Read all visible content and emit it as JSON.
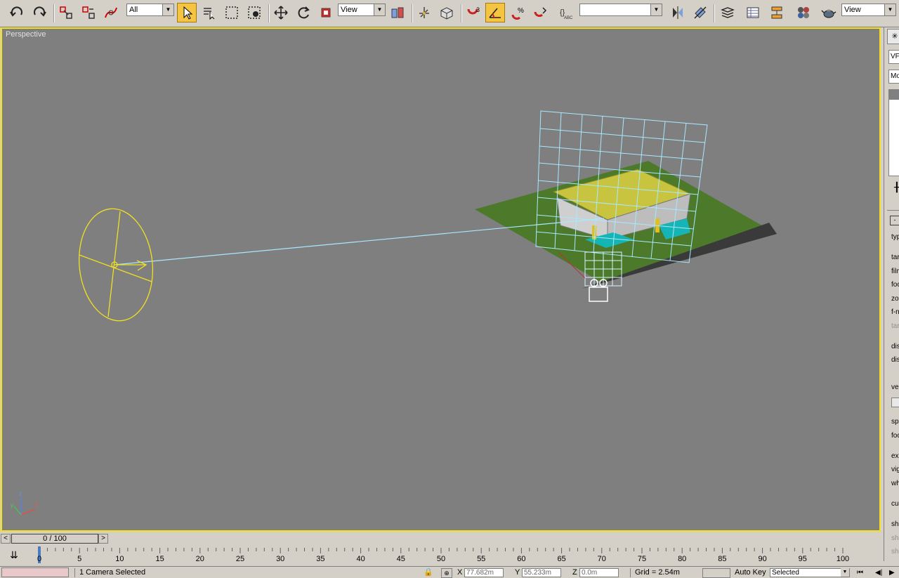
{
  "toolbar": {
    "selection_filter": "All",
    "ref_coord": "View",
    "named_selection": "",
    "view_dropdown": "View",
    "snap_label": "3"
  },
  "viewport": {
    "label": "Perspective",
    "axes": {
      "x": "x",
      "y": "y",
      "z": "z"
    }
  },
  "right_panel": {
    "items": [
      "VF",
      "Mo",
      "typ",
      "tar",
      "film",
      "foc",
      "zo",
      "f-n",
      "tar",
      "dis",
      "dis",
      "ve",
      "sp",
      "foc",
      "ex",
      "vig",
      "wh",
      "cu",
      "sh",
      "sh",
      "sh"
    ]
  },
  "timeline": {
    "frame_display": "0 / 100",
    "prev_btn": "<",
    "next_btn": ">",
    "ticks": [
      "0",
      "5",
      "10",
      "15",
      "20",
      "25",
      "30",
      "35",
      "40",
      "45",
      "50",
      "55",
      "60",
      "65",
      "70",
      "75",
      "80",
      "85",
      "90",
      "95",
      "100"
    ]
  },
  "status": {
    "selection": "1 Camera Selected",
    "x_label": "X",
    "x_value": "77.682m",
    "y_label": "Y",
    "y_value": "55.233m",
    "z_label": "Z",
    "z_value": "0.0m",
    "grid": "Grid = 2.54m",
    "auto_key": "Auto Key",
    "selected": "Selected"
  },
  "colors": {
    "viewport_bg": "#7f7f7f",
    "viewport_border": "#f5e11b",
    "camera_yellow": "#f0e020",
    "grid_cyan": "#a8e8ff",
    "active_btn": "#f5c542"
  }
}
